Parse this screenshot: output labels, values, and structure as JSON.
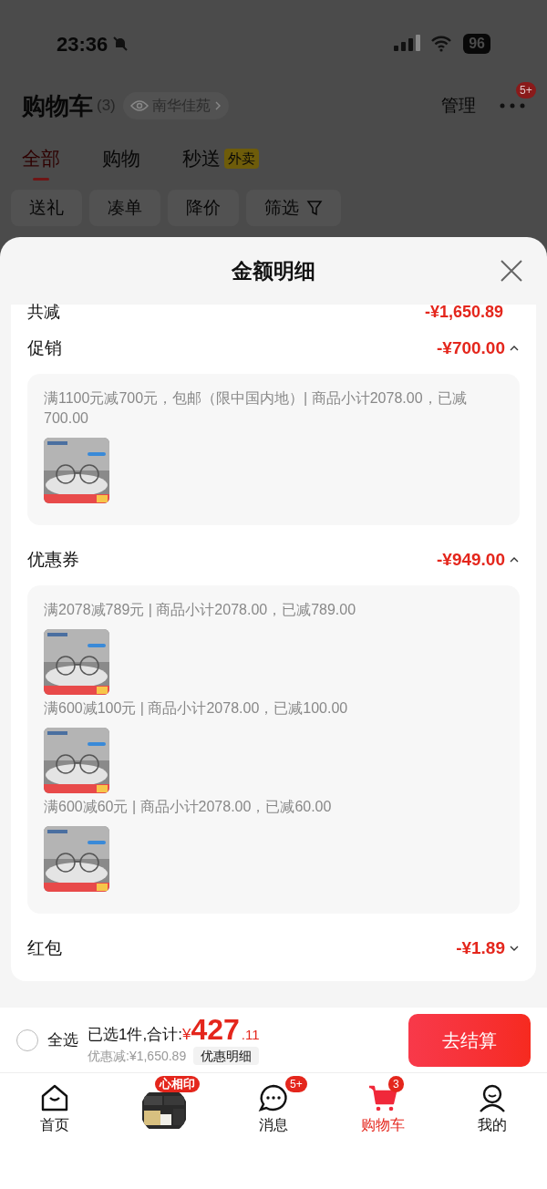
{
  "status_bar": {
    "time": "23:36",
    "battery": "96"
  },
  "header": {
    "title": "购物车",
    "count": "(3)",
    "location": "南华佳苑",
    "manage": "管理",
    "more_badge": "5+"
  },
  "tabs": [
    {
      "label": "全部",
      "selected": true
    },
    {
      "label": "购物",
      "selected": false
    },
    {
      "label": "秒送",
      "badge": "外卖",
      "selected": false
    }
  ],
  "filters": [
    {
      "label": "送礼",
      "kind": "chip"
    },
    {
      "label": "凑单",
      "kind": "chip"
    },
    {
      "label": "降价",
      "kind": "chip"
    },
    {
      "label": "筛选",
      "kind": "filter"
    }
  ],
  "sheet": {
    "title": "金额明细",
    "total": {
      "label": "共减",
      "amount": "-¥1,650.89"
    },
    "sections": [
      {
        "label": "促销",
        "amount": "-¥700.00",
        "expanded": true,
        "details": [
          {
            "text": "满1100元减700元，包邮（限中国内地）| 商品小计2078.00，已减700.00"
          }
        ]
      },
      {
        "label": "优惠券",
        "amount": "-¥949.00",
        "expanded": true,
        "details": [
          {
            "text": "满2078减789元 | 商品小计2078.00，已减789.00"
          },
          {
            "text": "满600减100元 | 商品小计2078.00，已减100.00"
          },
          {
            "text": "满600减60元 | 商品小计2078.00，已减60.00"
          }
        ]
      },
      {
        "label": "红包",
        "amount": "-¥1.89",
        "expanded": false
      }
    ]
  },
  "checkout_bar": {
    "select_all": {
      "label": "全选",
      "checked": false
    },
    "summary": "已选1件,合计:",
    "currency": "¥",
    "price_int": "427",
    "price_dec": ".11",
    "discount": "优惠减:¥1,650.89",
    "detail_button": "优惠明细",
    "checkout": "去结算"
  },
  "nav": [
    {
      "kind": "home",
      "label": "首页",
      "selected": false
    },
    {
      "kind": "promo",
      "badge": "心相印"
    },
    {
      "kind": "message",
      "label": "消息",
      "badge": "5+",
      "selected": false
    },
    {
      "kind": "cart",
      "label": "购物车",
      "badge": "3",
      "selected": true
    },
    {
      "kind": "profile",
      "label": "我的",
      "selected": false
    }
  ]
}
